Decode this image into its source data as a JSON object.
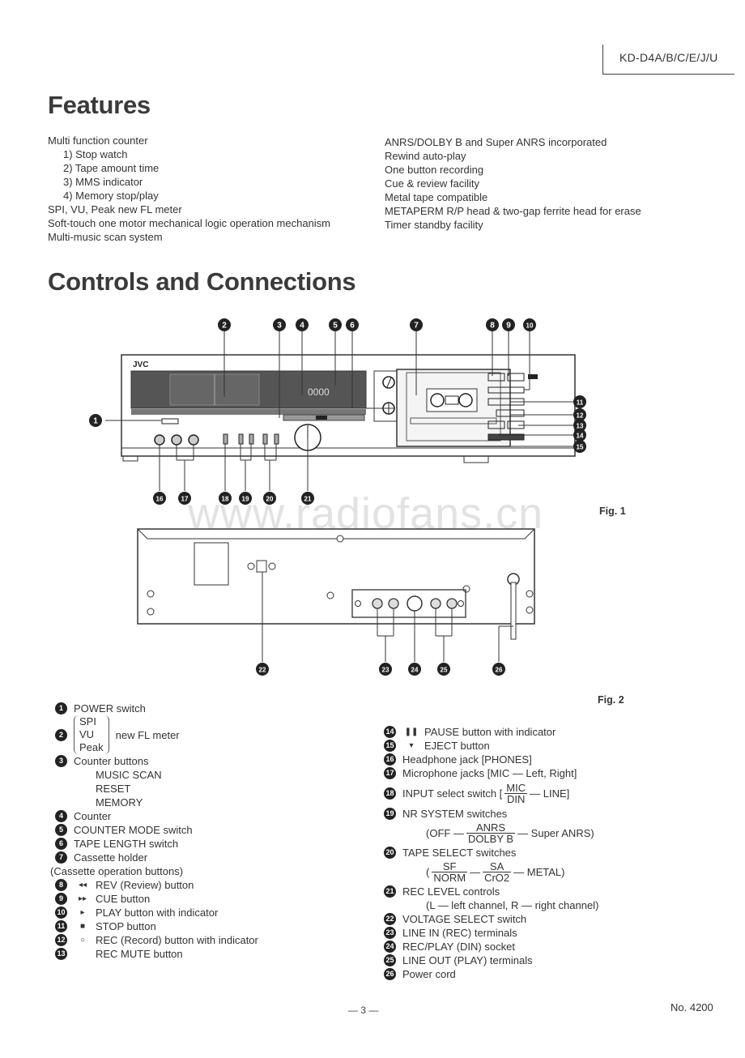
{
  "header": {
    "model": "KD-D4A/B/C/E/J/U"
  },
  "features": {
    "title": "Features",
    "left": [
      {
        "text": "Multi function counter",
        "indent": false
      },
      {
        "text": "1) Stop watch",
        "indent": true
      },
      {
        "text": "2) Tape amount time",
        "indent": true
      },
      {
        "text": "3) MMS indicator",
        "indent": true
      },
      {
        "text": "4) Memory stop/play",
        "indent": true
      },
      {
        "text": "SPI, VU, Peak new FL meter",
        "indent": false
      },
      {
        "text": "Soft-touch one motor mechanical logic operation mechanism",
        "indent": false
      },
      {
        "text": "Multi-music scan system",
        "indent": false
      }
    ],
    "right": [
      "ANRS/DOLBY B and Super ANRS incorporated",
      "Rewind auto-play",
      "One button recording",
      "Cue & review facility",
      "Metal tape compatible",
      "METAPERM R/P head & two-gap ferrite head for erase",
      "Timer standby facility"
    ]
  },
  "controls": {
    "title": "Controls and Connections",
    "fig1_label": "Fig. 1",
    "fig2_label": "Fig. 2",
    "watermark": "www.radiofans.cn",
    "front_panel": {
      "brand": "JVC",
      "counter_display": "0000"
    },
    "callouts_front_top": [
      "2",
      "3",
      "4",
      "5",
      "6",
      "7",
      "8",
      "9",
      "10"
    ],
    "callouts_front_right": [
      "11",
      "12",
      "13",
      "14",
      "15"
    ],
    "callouts_front_left": [
      "1"
    ],
    "callouts_front_bottom": [
      "16",
      "17",
      "18",
      "19",
      "20",
      "21"
    ],
    "callouts_rear": [
      "22",
      "23",
      "24",
      "25",
      "26"
    ]
  },
  "legend": {
    "left": [
      {
        "n": "1",
        "sym": "",
        "text": "POWER switch"
      },
      {
        "n": "2",
        "sym": "",
        "text": "new FL meter",
        "bracket": [
          "SPI",
          "VU",
          "Peak"
        ]
      },
      {
        "n": "3",
        "sym": "",
        "text": "Counter buttons",
        "sub": [
          "MUSIC SCAN",
          "RESET",
          "MEMORY"
        ]
      },
      {
        "n": "4",
        "sym": "",
        "text": "Counter"
      },
      {
        "n": "5",
        "sym": "",
        "text": "COUNTER MODE switch"
      },
      {
        "n": "6",
        "sym": "",
        "text": "TAPE LENGTH switch"
      },
      {
        "n": "7",
        "sym": "",
        "text": "Cassette holder"
      },
      {
        "heading": "(Cassette operation buttons)"
      },
      {
        "n": "8",
        "sym": "◂◂",
        "text": "REV (Review) button"
      },
      {
        "n": "9",
        "sym": "▸▸",
        "text": "CUE button"
      },
      {
        "n": "10",
        "sym": "▸",
        "text": "PLAY button with indicator"
      },
      {
        "n": "11",
        "sym": "■",
        "text": "STOP button"
      },
      {
        "n": "12",
        "sym": "○",
        "text": "REC (Record) button with indicator"
      },
      {
        "n": "13",
        "sym": "",
        "text": "REC MUTE button"
      }
    ],
    "right": [
      {
        "n": "14",
        "sym": "❚❚",
        "text": "PAUSE button with indicator"
      },
      {
        "n": "15",
        "sym": "▾",
        "text": "EJECT button"
      },
      {
        "n": "16",
        "text": "Headphone jack [PHONES]"
      },
      {
        "n": "17",
        "text": "Microphone jacks [MIC — Left, Right]"
      },
      {
        "n": "18",
        "text": "INPUT select switch [",
        "frac": [
          "MIC",
          "DIN"
        ],
        "after": "— LINE]"
      },
      {
        "n": "19",
        "text": "NR SYSTEM switches",
        "detail_pre": "(OFF —",
        "detail_frac": [
          "ANRS",
          "DOLBY B"
        ],
        "detail_post": "— Super ANRS)"
      },
      {
        "n": "20",
        "text": "TAPE SELECT switches",
        "detail_frac1": [
          "SF",
          "NORM"
        ],
        "detail_frac2": [
          "SA",
          "CrO2"
        ],
        "detail_post": "— METAL)"
      },
      {
        "n": "21",
        "text": "REC LEVEL controls",
        "detail": "(L — left channel, R — right channel)"
      },
      {
        "n": "22",
        "text": "VOLTAGE SELECT switch"
      },
      {
        "n": "23",
        "text": "LINE IN (REC) terminals"
      },
      {
        "n": "24",
        "text": "REC/PLAY (DIN) socket"
      },
      {
        "n": "25",
        "text": "LINE OUT (PLAY) terminals"
      },
      {
        "n": "26",
        "text": "Power cord"
      }
    ]
  },
  "footer": {
    "page": "— 3 —",
    "doc_no": "No. 4200"
  }
}
